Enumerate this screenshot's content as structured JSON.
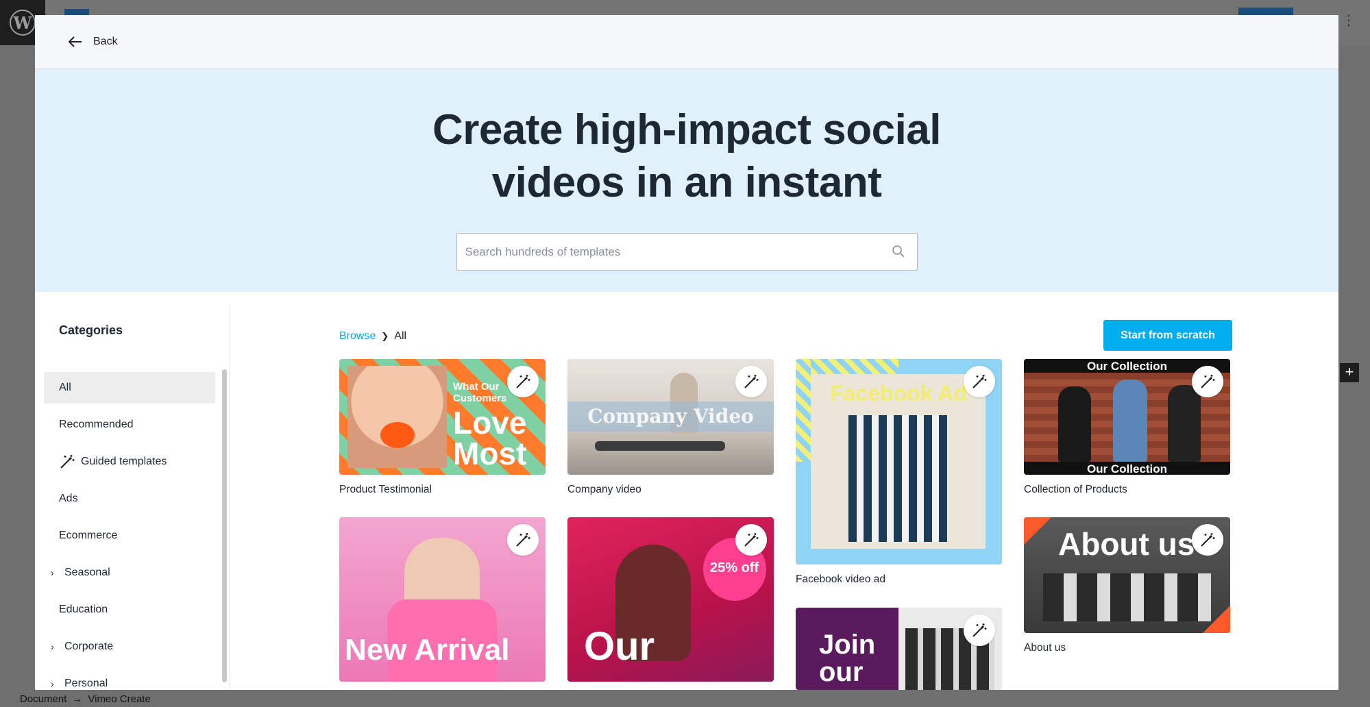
{
  "editor": {
    "footer_breadcrumb": [
      "Document",
      "Vimeo Create"
    ],
    "logo_letter": "W"
  },
  "modal": {
    "back_label": "Back",
    "hero_title_line1": "Create high-impact social",
    "hero_title_line2": "videos in an instant",
    "search_placeholder": "Search hundreds of templates"
  },
  "sidebar": {
    "title": "Categories",
    "items": [
      {
        "label": "All",
        "active": true,
        "expandable": false,
        "icon": null
      },
      {
        "label": "Recommended",
        "active": false,
        "expandable": false,
        "icon": null
      },
      {
        "label": "Guided templates",
        "active": false,
        "expandable": false,
        "icon": "magic-wand-icon"
      },
      {
        "label": "Ads",
        "active": false,
        "expandable": false,
        "icon": null
      },
      {
        "label": "Ecommerce",
        "active": false,
        "expandable": false,
        "icon": null
      },
      {
        "label": "Seasonal",
        "active": false,
        "expandable": true,
        "icon": null
      },
      {
        "label": "Education",
        "active": false,
        "expandable": false,
        "icon": null
      },
      {
        "label": "Corporate",
        "active": false,
        "expandable": true,
        "icon": null
      },
      {
        "label": "Personal",
        "active": false,
        "expandable": true,
        "icon": null
      }
    ]
  },
  "main": {
    "breadcrumb_link": "Browse",
    "breadcrumb_current": "All",
    "start_button": "Start from scratch"
  },
  "templates": [
    {
      "label": "Product Testimonial",
      "overlay": [
        "What Our",
        "Customers",
        "Love",
        "Most"
      ]
    },
    {
      "label": "Company video",
      "overlay": [
        "Company Video"
      ]
    },
    {
      "label": "Facebook video ad",
      "overlay": [
        "Facebook Ad"
      ]
    },
    {
      "label": "Collection of Products",
      "overlay": [
        "Our Collection",
        "Our Collection"
      ]
    },
    {
      "label": "",
      "overlay": [
        "New Arrival"
      ]
    },
    {
      "label": "",
      "overlay": [
        "25% off",
        "Our"
      ]
    },
    {
      "label": "",
      "overlay": [
        "Join",
        "our"
      ]
    },
    {
      "label": "About us",
      "overlay": [
        "About us"
      ]
    }
  ],
  "colors": {
    "accent": "#00adef",
    "link": "#00a5e8",
    "hero_bg": "#e1f1fb"
  }
}
